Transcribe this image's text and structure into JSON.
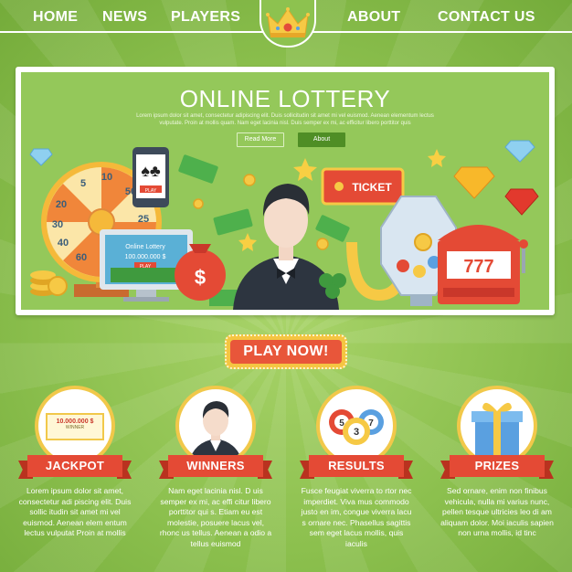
{
  "nav": {
    "items": [
      "HOME",
      "NEWS",
      "PLAYERS",
      "ABOUT",
      "CONTACT US"
    ]
  },
  "hero": {
    "title": "ONLINE LOTTERY",
    "text": "Lorem ipsum dolor sit amet, consectetur adipiscing elit. Duis sollicitudin sit amet mi vel euismod. Aenean elementum lectus vulputate. Proin at mollis quam. Nam eget lacinia nisl. Duis semper ex mi, ac efficitur libero porttitor quis",
    "read_more": "Read More",
    "about": "About",
    "phone_label": "PLAY",
    "monitor_title": "Online Lottery",
    "monitor_amount": "100.000.000 $",
    "monitor_button": "PLAY",
    "ticket_label": "TICKET",
    "slot_digits": "777",
    "bag_symbol": "$",
    "wheel_numbers": [
      "5",
      "10",
      "50",
      "20",
      "40",
      "30",
      "60",
      "25"
    ]
  },
  "play_button": "PLAY NOW!",
  "cards": [
    {
      "title": "JACKPOT",
      "badge_amount": "10.000.000 $",
      "badge_label": "WINNER",
      "text": "Lorem ipsum dolor sit amet, consectetur adi piscing elit. Duis sollic itudin sit amet mi vel euismod. Aenean elem entum lectus vulputat Proin at mollis"
    },
    {
      "title": "WINNERS",
      "text": "Nam eget lacinia nisl. D uis semper ex mi, ac effi citur libero porttitor qui s. Etiam eu est molestie, posuere lacus vel, rhonc us tellus. Aenean a odio a tellus euismod"
    },
    {
      "title": "RESULTS",
      "balls": [
        "5",
        "3",
        "7"
      ],
      "text": "Fusce feugiat viverra to rtor nec imperdiet. Viva mus commodo justo en im, congue viverra lacu s ornare nec. Phasellus sagittis sem eget lacus mollis, quis iaculis"
    },
    {
      "title": "PRIZES",
      "text": "Sed ornare, enim non finibus vehicula, nulla mi varius nunc, pellen tesque ultricies leo di am aliquam dolor. Moi iaculis sapien non urna mollis, id tinc"
    }
  ],
  "colors": {
    "background": "#8cc04e",
    "ribbon": "#e44a35",
    "gold": "#f1c84a",
    "hero": "#94c85a"
  }
}
